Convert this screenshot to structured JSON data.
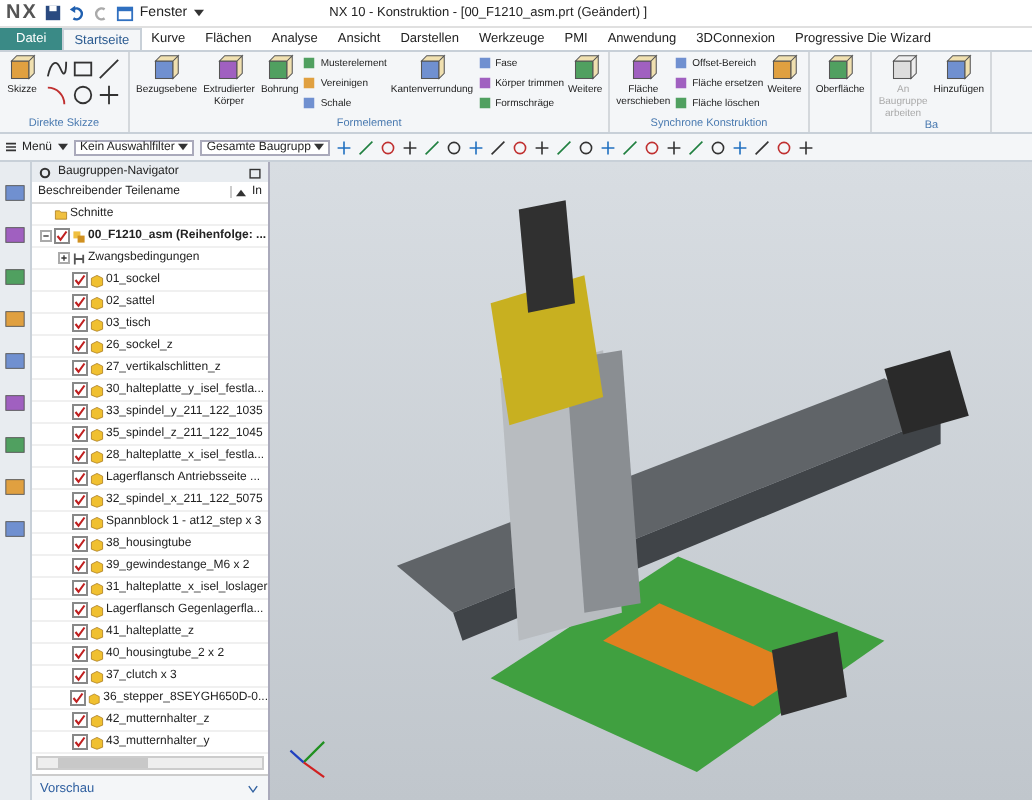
{
  "window": {
    "logo": "NX",
    "menu": "Fenster",
    "title": "NX 10 - Konstruktion - [00_F1210_asm.prt (Geändert) ]"
  },
  "tabs": [
    {
      "label": "Datei",
      "kind": "file",
      "selected": false
    },
    {
      "label": "Startseite",
      "kind": "tab",
      "selected": true
    },
    {
      "label": "Kurve",
      "kind": "tab",
      "selected": false
    },
    {
      "label": "Flächen",
      "kind": "tab",
      "selected": false
    },
    {
      "label": "Analyse",
      "kind": "tab",
      "selected": false
    },
    {
      "label": "Ansicht",
      "kind": "tab",
      "selected": false
    },
    {
      "label": "Darstellen",
      "kind": "tab",
      "selected": false
    },
    {
      "label": "Werkzeuge",
      "kind": "tab",
      "selected": false
    },
    {
      "label": "PMI",
      "kind": "tab",
      "selected": false
    },
    {
      "label": "Anwendung",
      "kind": "tab",
      "selected": false
    },
    {
      "label": "3DConnexion",
      "kind": "tab",
      "selected": false
    },
    {
      "label": "Progressive Die Wizard",
      "kind": "tab",
      "selected": false
    }
  ],
  "ribbon": [
    {
      "label": "Direkte Skizze",
      "items": [
        {
          "kind": "large",
          "label": "Skizze",
          "disabled": false
        },
        {
          "kind": "tools"
        }
      ]
    },
    {
      "label": "Formelement",
      "items": [
        {
          "kind": "large",
          "label": "Bezugsebene",
          "disabled": false
        },
        {
          "kind": "large",
          "label": "Extrudierter Körper",
          "disabled": false
        },
        {
          "kind": "large",
          "label": "Bohrung",
          "disabled": false
        },
        {
          "kind": "stack",
          "entries": [
            "Musterelement",
            "Vereinigen",
            "Schale"
          ]
        },
        {
          "kind": "large",
          "label": "Kantenverrundung",
          "disabled": false
        },
        {
          "kind": "stack",
          "entries": [
            "Fase",
            "Körper trimmen",
            "Formschräge"
          ]
        },
        {
          "kind": "large",
          "label": "Weitere",
          "disabled": false
        }
      ]
    },
    {
      "label": "Synchrone Konstruktion",
      "items": [
        {
          "kind": "large",
          "label": "Fläche verschieben",
          "disabled": false
        },
        {
          "kind": "stack",
          "entries": [
            "Offset-Bereich",
            "Fläche ersetzen",
            "Fläche löschen"
          ]
        },
        {
          "kind": "large",
          "label": "Weitere",
          "disabled": false
        }
      ]
    },
    {
      "items": [
        {
          "kind": "large",
          "label": "Oberfläche",
          "disabled": false
        }
      ]
    },
    {
      "label": "Ba",
      "items": [
        {
          "kind": "large",
          "label": "An Baugruppe arbeiten",
          "disabled": true
        },
        {
          "kind": "large",
          "label": "Hinzufügen",
          "disabled": false
        }
      ]
    }
  ],
  "toolbar": {
    "menu": "Menü",
    "filter": "Kein Auswahlfilter",
    "scope": "Gesamte Baugrupp"
  },
  "navigator": {
    "title": "Baugruppen-Navigator",
    "columns": [
      "Beschreibender Teilename",
      "In"
    ],
    "footer": "Vorschau",
    "tree": [
      {
        "kind": "folder",
        "label": "Schnitte"
      },
      {
        "kind": "assembly",
        "label": "00_F1210_asm (Reihenfolge: ...",
        "checked": true,
        "expanded": true,
        "children": [
          {
            "kind": "constraints",
            "label": "Zwangsbedingungen",
            "expanded": false
          },
          {
            "kind": "part",
            "label": "01_sockel",
            "checked": true
          },
          {
            "kind": "part",
            "label": "02_sattel",
            "checked": true
          },
          {
            "kind": "part",
            "label": "03_tisch",
            "checked": true
          },
          {
            "kind": "part",
            "label": "26_sockel_z",
            "checked": true
          },
          {
            "kind": "part",
            "label": "27_vertikalschlitten_z",
            "checked": true
          },
          {
            "kind": "part",
            "label": "30_halteplatte_y_isel_festla...",
            "checked": true
          },
          {
            "kind": "part",
            "label": "33_spindel_y_211_122_1035",
            "checked": true
          },
          {
            "kind": "part",
            "label": "35_spindel_z_211_122_1045",
            "checked": true
          },
          {
            "kind": "part",
            "label": "28_halteplatte_x_isel_festla...",
            "checked": true
          },
          {
            "kind": "part",
            "label": "Lagerflansch Antriebsseite ...",
            "checked": true
          },
          {
            "kind": "part",
            "label": "32_spindel_x_211_122_5075",
            "checked": true
          },
          {
            "kind": "part",
            "label": "Spannblock 1 - at12_step x 3",
            "checked": true
          },
          {
            "kind": "part",
            "label": "38_housingtube",
            "checked": true
          },
          {
            "kind": "part",
            "label": "39_gewindestange_M6 x 2",
            "checked": true
          },
          {
            "kind": "part",
            "label": "31_halteplatte_x_isel_loslager",
            "checked": true
          },
          {
            "kind": "part",
            "label": "Lagerflansch Gegenlagerfla...",
            "checked": true
          },
          {
            "kind": "part",
            "label": "41_halteplatte_z",
            "checked": true
          },
          {
            "kind": "part",
            "label": "40_housingtube_2 x 2",
            "checked": true
          },
          {
            "kind": "part",
            "label": "37_clutch x 3",
            "checked": true
          },
          {
            "kind": "part",
            "label": "36_stepper_8SEYGH650D-0...",
            "checked": true
          },
          {
            "kind": "part",
            "label": "42_mutternhalter_z",
            "checked": true
          },
          {
            "kind": "part",
            "label": "43_mutternhalter_y",
            "checked": true
          }
        ]
      }
    ]
  }
}
